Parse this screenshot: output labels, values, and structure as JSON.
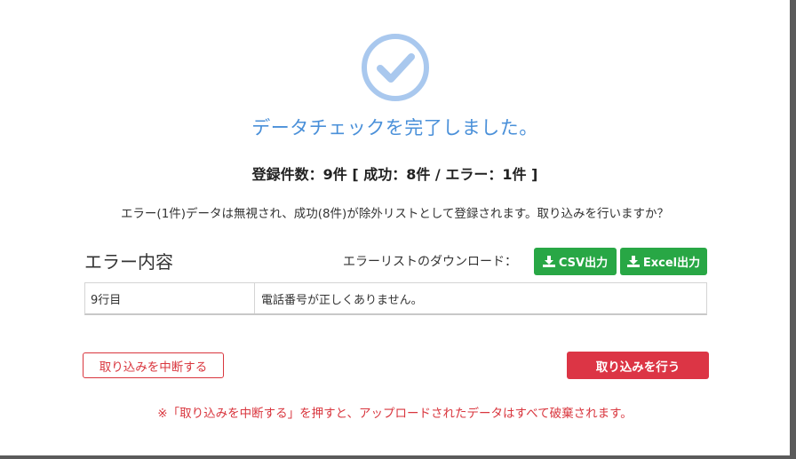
{
  "dialog": {
    "status_icon": "check-circle-icon",
    "title": "データチェックを完了しました。",
    "summary": "登録件数：9件 [ 成功：8件 / エラー：1件 ]",
    "description": "エラー(1件)データは無視され、成功(8件)が除外リストとして登録されます。取り込みを行いますか？"
  },
  "errors_section": {
    "title": "エラー内容",
    "download_label": "エラーリストのダウンロード：",
    "csv_button": "CSV出力",
    "excel_button": "Excel出力",
    "download_icon": "download-icon",
    "rows": [
      {
        "row": "9行目",
        "message": "電話番号が正しくありません。"
      }
    ]
  },
  "actions": {
    "cancel_label": "取り込みを中断する",
    "import_label": "取り込みを行う",
    "note": "※「取り込みを中断する」を押すと、アップロードされたデータはすべて破棄されます。"
  },
  "colors": {
    "title_blue": "#4a90d9",
    "check_blue": "#a9c8ee",
    "success_green": "#28a745",
    "danger_red": "#dc3545"
  }
}
